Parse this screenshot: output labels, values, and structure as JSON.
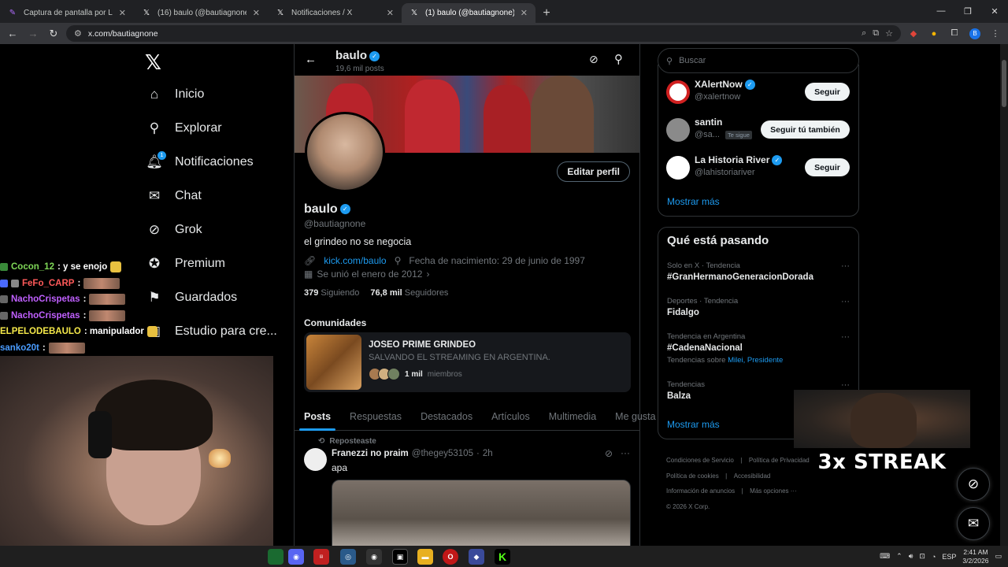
{
  "browser": {
    "tabs": [
      {
        "title": "Captura de pantalla por Lightsh",
        "active": false
      },
      {
        "title": "(16) baulo (@bautiagnone) / X",
        "active": false
      },
      {
        "title": "Notificaciones / X",
        "active": false
      },
      {
        "title": "(1) baulo (@bautiagnone) / X",
        "active": true
      }
    ],
    "url": "x.com/bautiagnone",
    "profile_initial": "B"
  },
  "nav": {
    "items": [
      {
        "label": "Inicio",
        "icon": "home-icon"
      },
      {
        "label": "Explorar",
        "icon": "search-icon"
      },
      {
        "label": "Notificaciones",
        "icon": "bell-icon",
        "badge": "1"
      },
      {
        "label": "Chat",
        "icon": "mail-icon"
      },
      {
        "label": "Grok",
        "icon": "grok-icon"
      },
      {
        "label": "Premium",
        "icon": "premium-icon"
      },
      {
        "label": "Guardados",
        "icon": "bookmark-icon"
      },
      {
        "label": "Estudio para cre...",
        "icon": "studio-icon"
      }
    ]
  },
  "header": {
    "name": "baulo",
    "posts": "19,6 mil posts"
  },
  "profile": {
    "name": "baulo",
    "handle": "@bautiagnone",
    "bio": "el grindeo no se negocia",
    "link": "kick.com/baulo",
    "birthday": "Fecha de nacimiento: 29 de junio de 1997",
    "joined": "Se unió el enero de 2012",
    "following_count": "379",
    "following_label": "Siguiendo",
    "followers_count": "76,8 mil",
    "followers_label": "Seguidores",
    "edit_label": "Editar perfil"
  },
  "communities": {
    "heading": "Comunidades",
    "name": "JOSEO PRIME GRINDEO",
    "description": "SALVANDO EL STREAMING EN ARGENTINA.",
    "members_count": "1 mil",
    "members_label": "miembros"
  },
  "tabs": [
    "Posts",
    "Respuestas",
    "Destacados",
    "Artículos",
    "Multimedia",
    "Me gusta"
  ],
  "post": {
    "repost_label": "Reposteaste",
    "author": "Franezzi no praim",
    "handle": "@thegey53105",
    "time": "2h",
    "text": "apa"
  },
  "search": {
    "placeholder": "Buscar"
  },
  "who_to_follow": [
    {
      "name": "XAlertNow",
      "handle": "@xalertnow",
      "button": "Seguir",
      "verified": true
    },
    {
      "name": "santin",
      "handle": "@sa...",
      "follows_you": "Te sigue",
      "button": "Seguir tú también",
      "verified": false
    },
    {
      "name": "La Historia River",
      "handle": "@lahistoriariver",
      "button": "Seguir",
      "verified": true
    }
  ],
  "show_more_1": "Mostrar más",
  "trending": {
    "heading": "Qué está pasando",
    "items": [
      {
        "meta": "Solo en X · Tendencia",
        "name": "#GranHermanoGeneracionDorada"
      },
      {
        "meta": "Deportes · Tendencia",
        "name": "Fidalgo"
      },
      {
        "meta": "Tendencia en Argentina",
        "name": "#CadenaNacional",
        "sub_prefix": "Tendencias sobre",
        "sub_links": "Milei, Presidente"
      },
      {
        "meta": "Tendencias",
        "name": "Balza"
      }
    ],
    "show_more": "Mostrar más"
  },
  "footer": {
    "links": [
      "Condiciones de Servicio",
      "Política de Privacidad",
      "Política de cookies",
      "Accesibilidad",
      "Información de anuncios",
      "Más opciones ···"
    ],
    "copyright": "© 2026 X Corp."
  },
  "stream": {
    "chat": [
      {
        "user": "Cocon_12",
        "msg": ": y se enojo",
        "color": "#7fd858"
      },
      {
        "user": "FeFo_CARP",
        "msg": ":",
        "color": "#ff5a5a"
      },
      {
        "user": "NachoCrispetas",
        "msg": ":",
        "color": "#c060ff"
      },
      {
        "user": "NachoCrispetas",
        "msg": ":",
        "color": "#c060ff"
      },
      {
        "user": "ELPELODEBAULO",
        "msg": ": manipulador",
        "color": "#f5e94a"
      },
      {
        "user": "sanko20t",
        "msg": ":",
        "color": "#4a9cff"
      }
    ],
    "streak_text": "3x STREAK"
  },
  "taskbar": {
    "lang": "ESP",
    "time": "2:41 AM",
    "date": "3/2/2026"
  }
}
